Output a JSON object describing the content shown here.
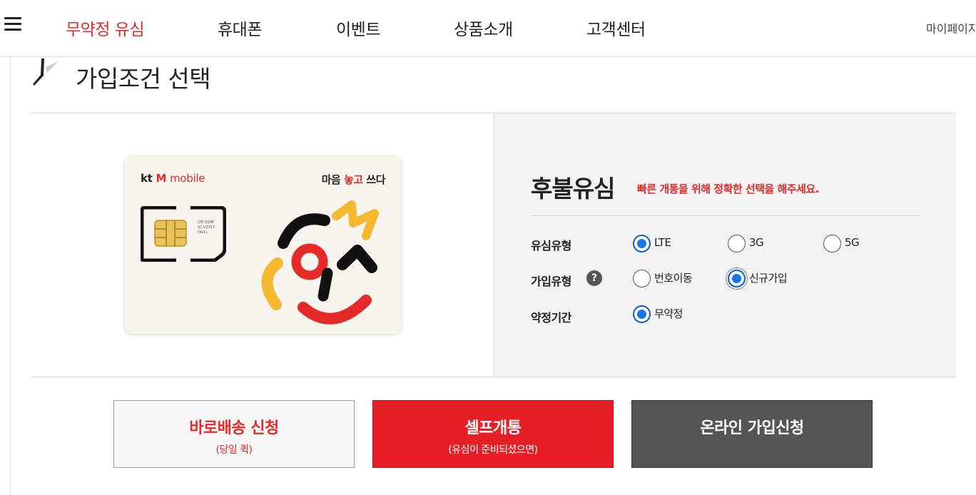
{
  "nav": {
    "menu_icon": "hamburger-menu-icon",
    "items": [
      {
        "label": "무약정 유심",
        "active": true
      },
      {
        "label": "휴대폰",
        "active": false
      },
      {
        "label": "이벤트",
        "active": false
      },
      {
        "label": "상품소개",
        "active": false
      },
      {
        "label": "고객센터",
        "active": false
      }
    ],
    "mypage": "마이페이지"
  },
  "section": {
    "title": "가입조건 선택"
  },
  "sim_card": {
    "brand_kt": "kt",
    "brand_m": "M",
    "brand_mobile": "mobile",
    "slogan_a": "마음 ",
    "slogan_b": "놓고",
    "slogan_c": " 쓰다",
    "chip_text": [
      "LTE USIM",
      "SC-V2317",
      "(9e1)"
    ]
  },
  "plan": {
    "title": "후불유심",
    "hint": "빠른 개통을 위해 정확한 선택을 해주세요."
  },
  "options": {
    "usim_type": {
      "label": "유심유형",
      "choices": [
        {
          "label": "LTE",
          "selected": true
        },
        {
          "label": "3G",
          "selected": false
        },
        {
          "label": "5G",
          "selected": false
        }
      ]
    },
    "join_type": {
      "label": "가입유형",
      "help_icon": "?",
      "choices": [
        {
          "label": "번호이동",
          "selected": false
        },
        {
          "label": "신규가입",
          "selected": true
        }
      ]
    },
    "contract": {
      "label": "약정기간",
      "choices": [
        {
          "label": "무약정",
          "selected": true
        }
      ]
    }
  },
  "buttons": {
    "delivery": {
      "label": "바로배송 신청",
      "sub": "(당일 퀵)"
    },
    "self": {
      "label": "셀프개통",
      "sub": "(유심이 준비되셨으면)"
    },
    "online": {
      "label": "온라인 가입신청"
    }
  },
  "colors": {
    "accent_red": "#e52a2a",
    "button_red": "#e51f25",
    "button_dark": "#555555",
    "radio_blue": "#1a73e8"
  }
}
